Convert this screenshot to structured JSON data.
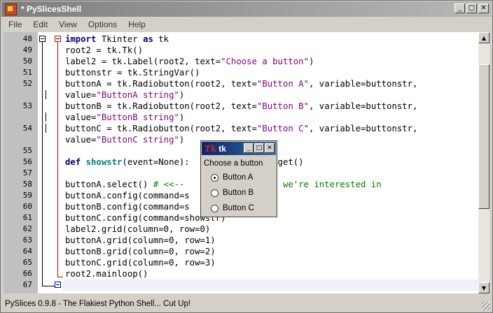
{
  "window": {
    "title": "* PySlicesShell"
  },
  "menu": [
    "File",
    "Edit",
    "View",
    "Options",
    "Help"
  ],
  "editor": {
    "line_numbers": [
      "48",
      "49",
      "50",
      "51",
      "52",
      "",
      "53",
      "",
      "54",
      "",
      "55",
      "56",
      "57",
      "58",
      "59",
      "60",
      "61",
      "62",
      "63",
      "64",
      "65",
      "66",
      "67"
    ],
    "lines": [
      [
        {
          "t": "import",
          "c": "kw"
        },
        {
          "t": " Tkinter "
        },
        {
          "t": "as",
          "c": "kw"
        },
        {
          "t": " tk"
        }
      ],
      [
        {
          "t": "root2 = tk.Tk()"
        }
      ],
      [
        {
          "t": "label2 = tk.Label(root2, text="
        },
        {
          "t": "\"Choose a button\"",
          "c": "str"
        },
        {
          "t": ")"
        }
      ],
      [
        {
          "t": "buttonstr = tk.StringVar()"
        }
      ],
      [
        {
          "t": "buttonA = tk.Radiobutton(root2, text="
        },
        {
          "t": "\"Button A\"",
          "c": "str"
        },
        {
          "t": ", variable=buttonstr,"
        }
      ],
      [
        {
          "t": "value="
        },
        {
          "t": "\"ButtonA string\"",
          "c": "str"
        },
        {
          "t": ")"
        }
      ],
      [
        {
          "t": "buttonB = tk.Radiobutton(root2, text="
        },
        {
          "t": "\"Button B\"",
          "c": "str"
        },
        {
          "t": ", variable=buttonstr,"
        }
      ],
      [
        {
          "t": "value="
        },
        {
          "t": "\"ButtonB string\"",
          "c": "str"
        },
        {
          "t": ")"
        }
      ],
      [
        {
          "t": "buttonC = tk.Radiobutton(root2, text="
        },
        {
          "t": "\"Button C\"",
          "c": "str"
        },
        {
          "t": ", variable=buttonstr,"
        }
      ],
      [
        {
          "t": "value="
        },
        {
          "t": "\"ButtonC string\"",
          "c": "str"
        },
        {
          "t": ")"
        }
      ],
      [],
      [
        {
          "t": "def",
          "c": "kw"
        },
        {
          "t": " "
        },
        {
          "t": "showstr",
          "c": "fn"
        },
        {
          "t": "(event=None):              tr.get()"
        }
      ],
      [],
      [
        {
          "t": "buttonA.select() "
        },
        {
          "t": "# <<--                   we're interested in",
          "c": "cmt"
        }
      ],
      [
        {
          "t": "buttonA.config(command=s"
        }
      ],
      [
        {
          "t": "buttonB.config(command=s"
        }
      ],
      [
        {
          "t": "buttonC.config(command=showstr)"
        }
      ],
      [
        {
          "t": "label2.grid(column=0, row=0)"
        }
      ],
      [
        {
          "t": "buttonA.grid(column=0, row=1)"
        }
      ],
      [
        {
          "t": "buttonB.grid(column=0, row=2)"
        }
      ],
      [
        {
          "t": "buttonC.grid(column=0, row=3)"
        }
      ],
      [
        {
          "t": "root2.mainloop()"
        }
      ],
      []
    ]
  },
  "tk_window": {
    "title": "tk",
    "logo": "Tk",
    "label": "Choose a button",
    "options": [
      {
        "label": "Button A",
        "selected": true
      },
      {
        "label": "Button B",
        "selected": false
      },
      {
        "label": "Button C",
        "selected": false
      }
    ]
  },
  "status": {
    "text": "PySlices 0.9.8 - The Flakiest Python Shell... Cut Up!"
  },
  "colors": {
    "keyword": "#00007f",
    "string": "#7f007f",
    "comment": "#007f00",
    "function": "#007f7f",
    "fold_marker": "#cc0000"
  }
}
